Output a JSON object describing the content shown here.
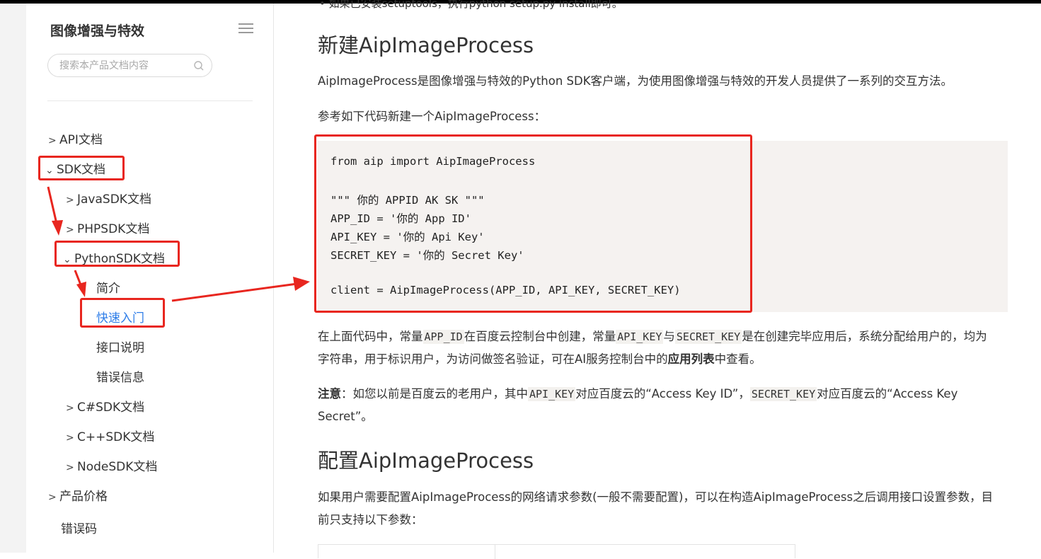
{
  "sidebar": {
    "title": "图像增强与特效",
    "search_placeholder": "搜索本产品文档内容",
    "items": [
      {
        "label": "API文档",
        "chevron": ">"
      },
      {
        "label": "SDK文档",
        "chevron": "⌄"
      },
      {
        "label": "JavaSDK文档",
        "chevron": ">"
      },
      {
        "label": "PHPSDK文档",
        "chevron": ">"
      },
      {
        "label": "PythonSDK文档",
        "chevron": "⌄"
      },
      {
        "label": "简介"
      },
      {
        "label": "快速入门"
      },
      {
        "label": "接口说明"
      },
      {
        "label": "错误信息"
      },
      {
        "label": "C#SDK文档",
        "chevron": ">"
      },
      {
        "label": "C++SDK文档",
        "chevron": ">"
      },
      {
        "label": "NodeSDK文档",
        "chevron": ">"
      },
      {
        "label": "产品价格",
        "chevron": ">"
      },
      {
        "label": "错误码"
      }
    ]
  },
  "main": {
    "cut_text": "• 如果已安装setuptools，执行python setup.py install即可。",
    "h_new": "新建AipImageProcess",
    "p_intro": "AipImageProcess是图像增强与特效的Python SDK客户端，为使用图像增强与特效的开发人员提供了一系列的交互方法。",
    "p_ref": "参考如下代码新建一个AipImageProcess：",
    "code_lines": [
      "from aip import AipImageProcess",
      "\"\"\" 你的 APPID AK SK \"\"\"",
      "APP_ID = '你的 App ID'",
      "API_KEY = '你的 Api Key'",
      "SECRET_KEY = '你的 Secret Key'",
      "client = AipImageProcess(APP_ID, API_KEY, SECRET_KEY)"
    ],
    "p_consts": {
      "t1": "在上面代码中，常量",
      "c1": "APP_ID",
      "t2": "在百度云控制台中创建，常量",
      "c2": "API_KEY",
      "t3": "与",
      "c3": "SECRET_KEY",
      "t4": "是在创建完毕应用后，系统分配给用户的，均为字符串，用于标识用户，为访问做签名验证，可在AI服务控制台中的",
      "b1": "应用列表",
      "t5": "中查看。"
    },
    "p_note": {
      "b": "注意",
      "t1": "：如您以前是百度云的老用户，其中",
      "c1": "API_KEY",
      "t2": "对应百度云的“Access Key ID”，",
      "c2": "SECRET_KEY",
      "t3": "对应百度云的“Access Key Secret”。"
    },
    "h_config": "配置AipImageProcess",
    "p_config": "如果用户需要配置AipImageProcess的网络请求参数(一般不需要配置)，可以在构造AipImageProcess之后调用接口设置参数，目前只支持以下参数："
  },
  "colors": {
    "annotation": "#e8261f",
    "active_link": "#2f7ee8",
    "code_bg": "#f5f2f0"
  }
}
